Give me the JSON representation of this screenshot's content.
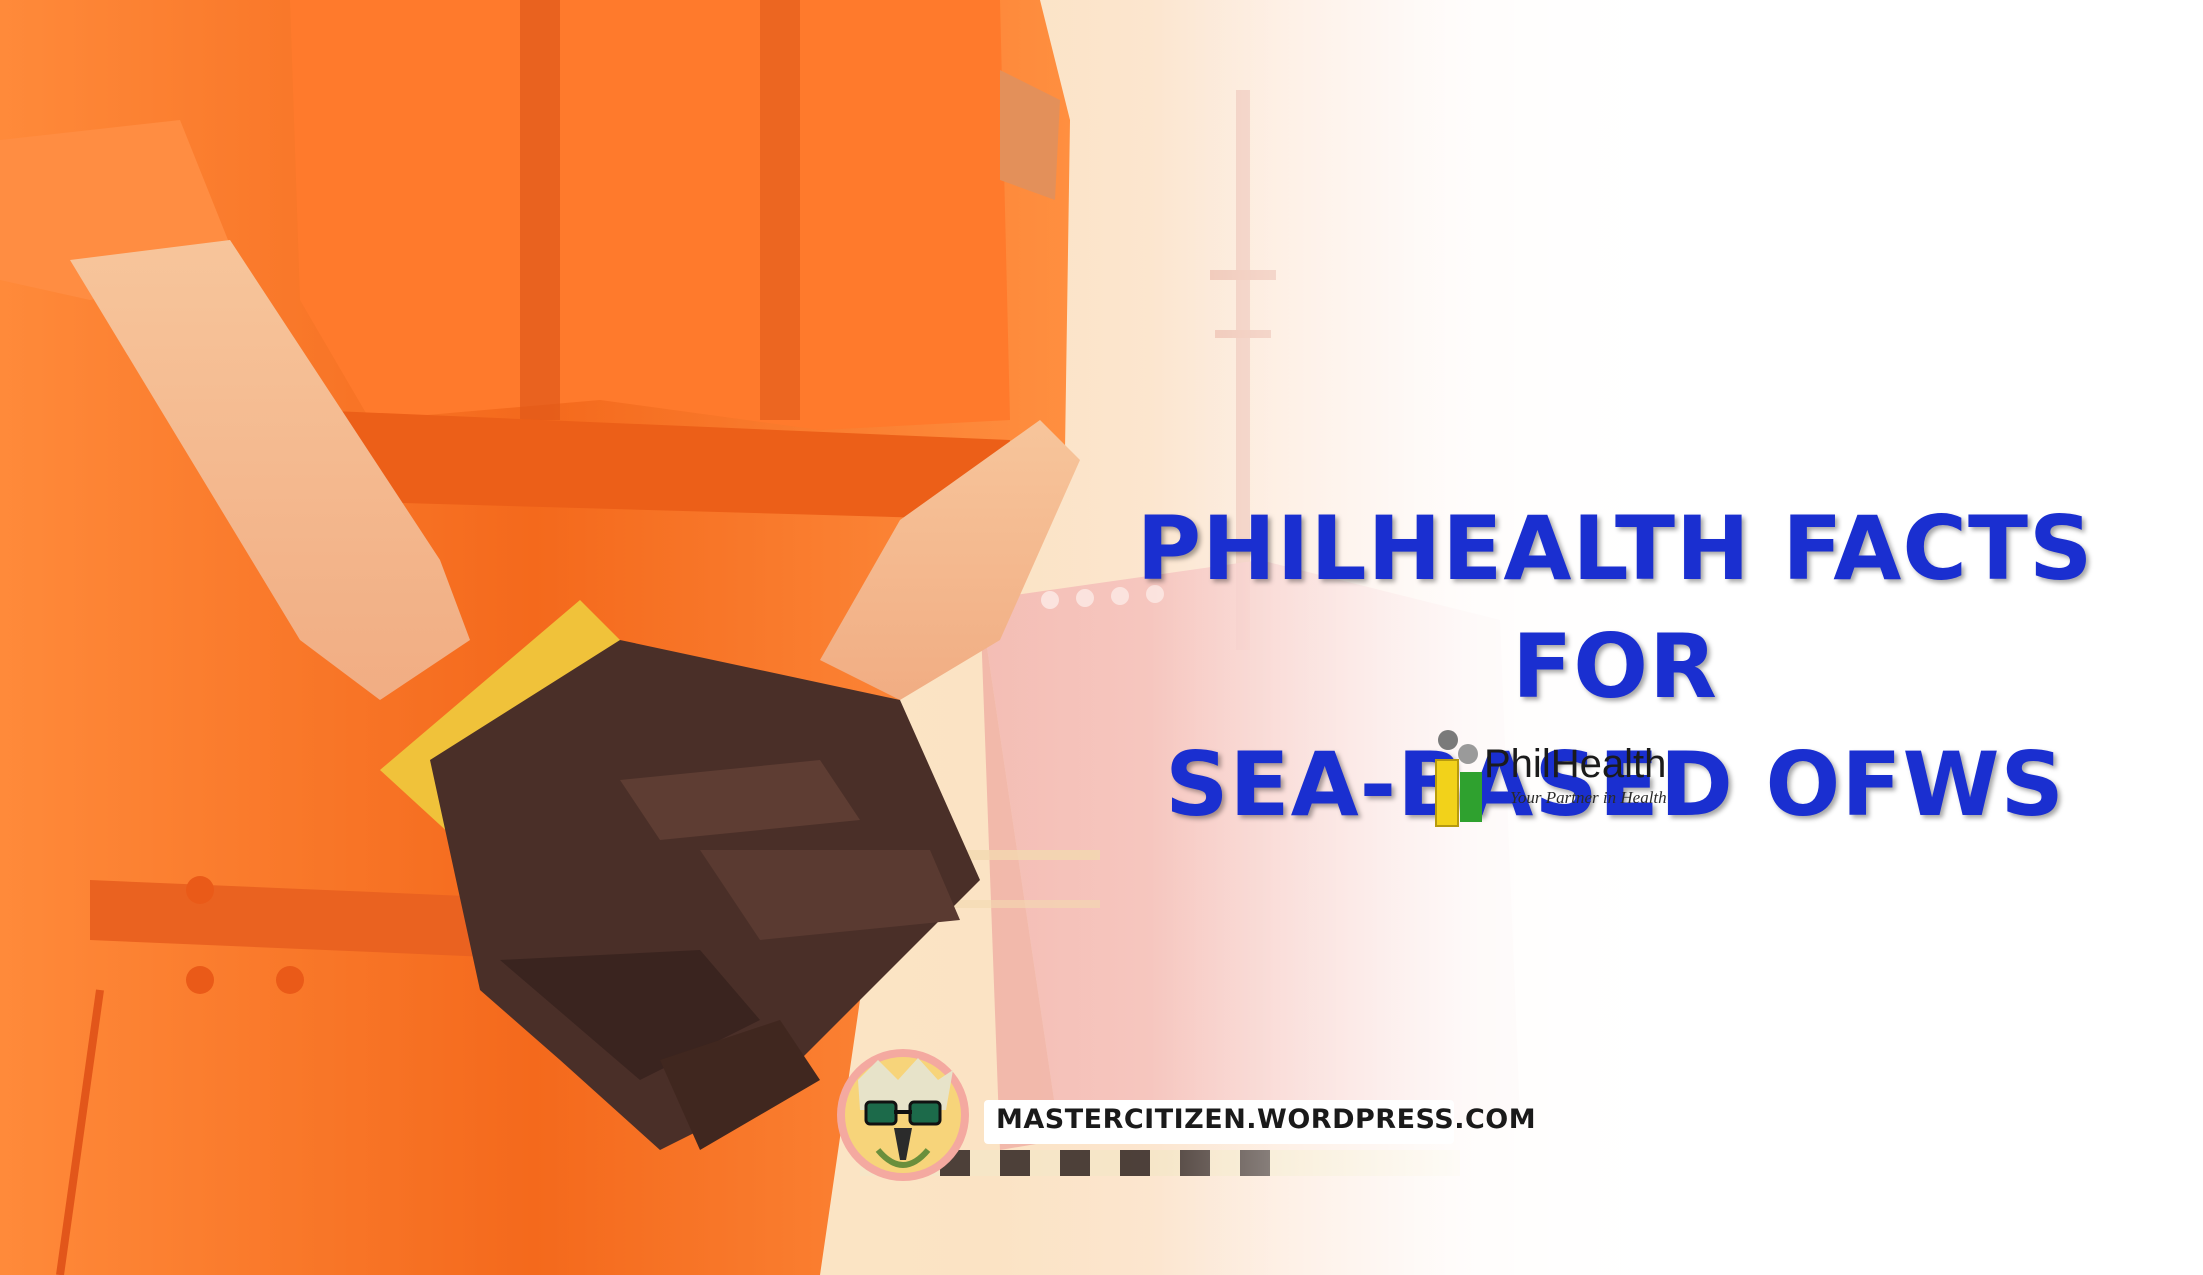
{
  "headline": {
    "line1": "PHILHEALTH FACTS FOR",
    "line2": "SEA-BASED OFWS"
  },
  "logo": {
    "name": "PhilHealth",
    "tagline": "Your Partner in Health",
    "icon": "philhealth-logo-icon"
  },
  "watermark": {
    "icon": "eagle-mascot-icon",
    "url": "MASTERCITIZEN.WORDPRESS.COM"
  },
  "colors": {
    "headline": "#1a2fd0",
    "coverall_orange": "#f26a1e",
    "glove": "#4a2f28",
    "glove_cuff": "#f0c23a"
  }
}
